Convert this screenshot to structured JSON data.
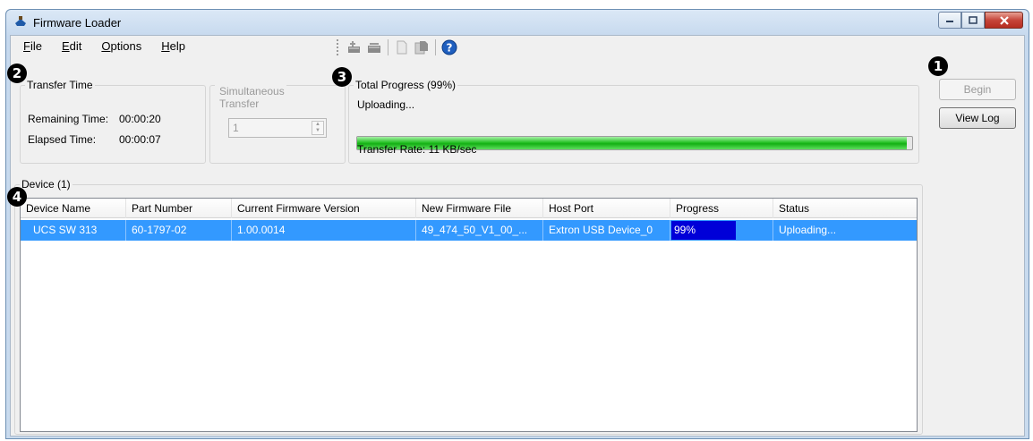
{
  "window": {
    "title": "Firmware Loader"
  },
  "menu": [
    {
      "underline": "F",
      "rest": "ile"
    },
    {
      "underline": "E",
      "rest": "dit"
    },
    {
      "underline": "O",
      "rest": "ptions"
    },
    {
      "underline": "H",
      "rest": "elp"
    }
  ],
  "toolbar": {
    "icons": [
      "add-device-icon",
      "remove-device-icon",
      "new-file-icon",
      "open-files-icon",
      "help-icon"
    ]
  },
  "markers": {
    "one": "1",
    "two": "2",
    "three": "3",
    "four": "4"
  },
  "transfer_time": {
    "legend": "Transfer Time",
    "remaining_label": "Remaining Time:",
    "remaining_value": "00:00:20",
    "elapsed_label": "Elapsed Time:",
    "elapsed_value": "00:00:07"
  },
  "simultaneous": {
    "legend_line1": "Simultaneous",
    "legend_line2": "Transfer",
    "value": "1"
  },
  "total_progress": {
    "legend": "Total Progress (99%)",
    "status": "Uploading...",
    "percent": 99,
    "rate": "Transfer Rate: 11 KB/sec"
  },
  "buttons": {
    "begin": "Begin",
    "view_log": "View Log"
  },
  "device_group": {
    "legend": "Device (1)"
  },
  "table": {
    "columns": [
      "Device Name",
      "Part Number",
      "Current Firmware Version",
      "New Firmware File",
      "Host Port",
      "Progress",
      "Status"
    ],
    "rows": [
      {
        "device_name": "UCS SW 313",
        "part_number": "60-1797-02",
        "current_version": "1.00.0014",
        "new_file": "49_474_50_V1_00_...",
        "host_port": "Extron USB Device_0",
        "progress": "99%",
        "progress_value": 99,
        "status": "Uploading..."
      }
    ]
  },
  "colors": {
    "selection": "#3399ff",
    "row_progress": "#0000d8",
    "progress_green": "#27c227"
  }
}
